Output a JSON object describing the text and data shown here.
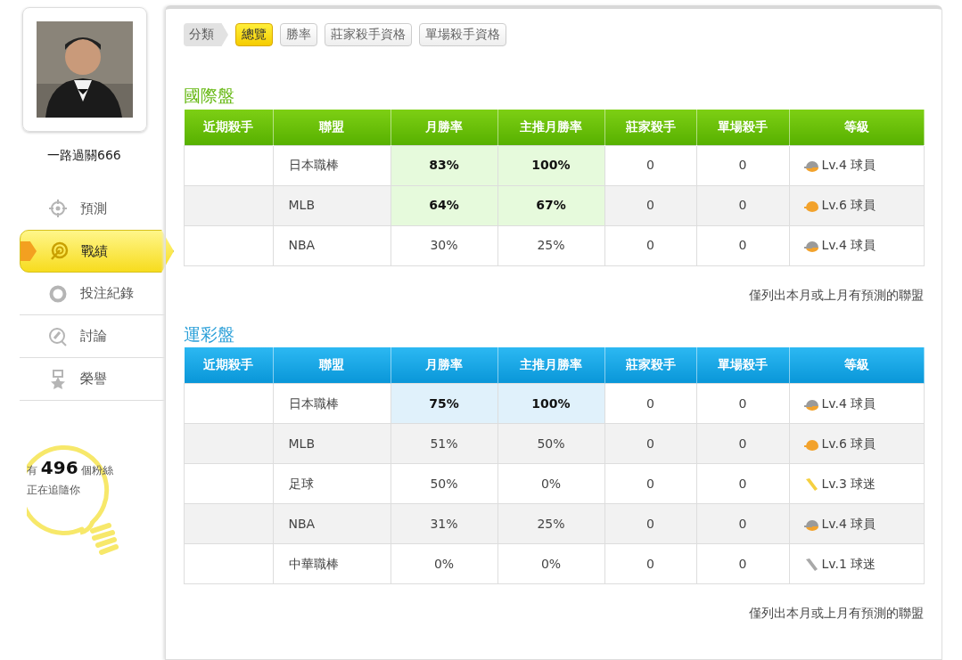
{
  "profile": {
    "username": "一路過關666"
  },
  "nav": [
    {
      "label": "預測",
      "selected": false
    },
    {
      "label": "戰績",
      "selected": true
    },
    {
      "label": "投注紀錄",
      "selected": false
    },
    {
      "label": "討論",
      "selected": false
    },
    {
      "label": "榮譽",
      "selected": false
    }
  ],
  "fans": {
    "text": "有 **496** 個粉絲正在追隨你"
  },
  "filter": {
    "label": "分類",
    "options": [
      {
        "label": "總覽",
        "selected": true
      },
      {
        "label": "勝率",
        "selected": false
      },
      {
        "label": "莊家殺手資格",
        "selected": false
      },
      {
        "label": "單場殺手資格",
        "selected": false
      }
    ]
  },
  "sections": [
    {
      "title": "國際盤",
      "columns": [
        "近期殺手",
        "聯盟",
        "月勝率",
        "主推月勝率",
        "莊家殺手",
        "單場殺手",
        "等級"
      ],
      "rows": [
        {
          "league": "日本職棒",
          "month_rate": "83%",
          "top_rate": "100%",
          "banker_killer": "0",
          "single_killer": "0",
          "level": {
            "kind": "helmet",
            "color": "#9a9a9a",
            "label": "Lv.4 球員"
          },
          "highlight": true
        },
        {
          "league": "MLB",
          "month_rate": "64%",
          "top_rate": "67%",
          "banker_killer": "0",
          "single_killer": "0",
          "level": {
            "kind": "helmet",
            "color": "#f2a22c",
            "label": "Lv.6 球員"
          },
          "highlight": true
        },
        {
          "league": "NBA",
          "month_rate": "30%",
          "top_rate": "25%",
          "banker_killer": "0",
          "single_killer": "0",
          "level": {
            "kind": "helmet",
            "color": "#9a9a9a",
            "label": "Lv.4 球員"
          },
          "highlight": false
        }
      ],
      "note": "僅列出本月或上月有預測的聯盟"
    },
    {
      "title": "運彩盤",
      "columns": [
        "近期殺手",
        "聯盟",
        "月勝率",
        "主推月勝率",
        "莊家殺手",
        "單場殺手",
        "等級"
      ],
      "rows": [
        {
          "league": "日本職棒",
          "month_rate": "75%",
          "top_rate": "100%",
          "banker_killer": "0",
          "single_killer": "0",
          "level": {
            "kind": "helmet",
            "color": "#9a9a9a",
            "label": "Lv.4 球員"
          },
          "highlight": true
        },
        {
          "league": "MLB",
          "month_rate": "51%",
          "top_rate": "50%",
          "banker_killer": "0",
          "single_killer": "0",
          "level": {
            "kind": "helmet",
            "color": "#f2a22c",
            "label": "Lv.6 球員"
          },
          "highlight": false
        },
        {
          "league": "足球",
          "month_rate": "50%",
          "top_rate": "0%",
          "banker_killer": "0",
          "single_killer": "0",
          "level": {
            "kind": "bat",
            "color": "#f5d040",
            "label": "Lv.3 球迷"
          },
          "highlight": false
        },
        {
          "league": "NBA",
          "month_rate": "31%",
          "top_rate": "25%",
          "banker_killer": "0",
          "single_killer": "0",
          "level": {
            "kind": "helmet",
            "color": "#9a9a9a",
            "label": "Lv.4 球員"
          },
          "highlight": false
        },
        {
          "league": "中華職棒",
          "month_rate": "0%",
          "top_rate": "0%",
          "banker_killer": "0",
          "single_killer": "0",
          "level": {
            "kind": "bat",
            "color": "#a8a8a8",
            "label": "Lv.1 球迷"
          },
          "highlight": false
        }
      ],
      "note": "僅列出本月或上月有預測的聯盟"
    }
  ]
}
